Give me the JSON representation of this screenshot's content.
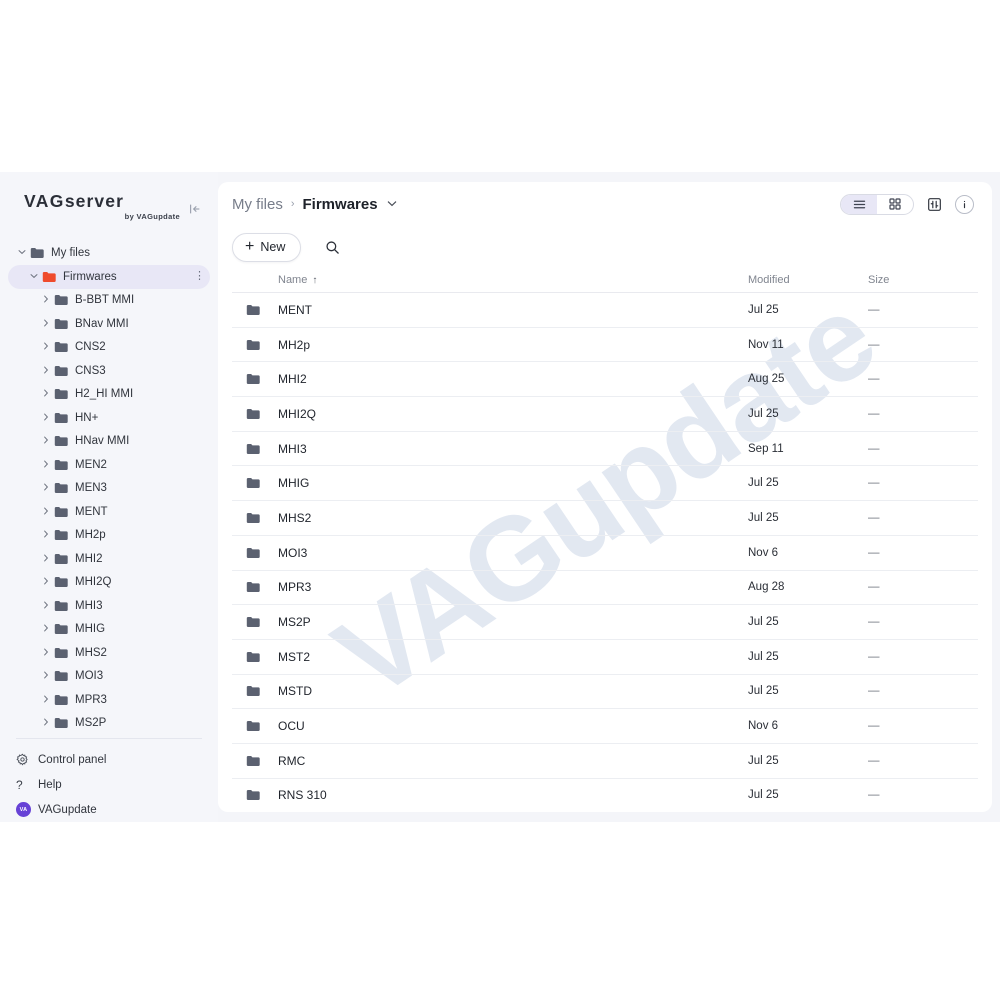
{
  "brand": {
    "title_bold": "VAG",
    "title_light": "server",
    "subtitle": "by VAGupdate",
    "collapse_icon": "collapse-sidebar-icon"
  },
  "watermark": "VAGupdate",
  "sidebar": {
    "tree": [
      {
        "label": "My files",
        "depth": 0,
        "chevron": "down",
        "selected": false,
        "folder_color": "#5b6170"
      },
      {
        "label": "Firmwares",
        "depth": 1,
        "chevron": "down",
        "selected": true,
        "folder_color": "#ef4a2c",
        "kebab": "⋮"
      },
      {
        "label": "B-BBT MMI",
        "depth": 2,
        "chevron": "right",
        "selected": false,
        "folder_color": "#5b6170"
      },
      {
        "label": "BNav MMI",
        "depth": 2,
        "chevron": "right",
        "selected": false,
        "folder_color": "#5b6170"
      },
      {
        "label": "CNS2",
        "depth": 2,
        "chevron": "right",
        "selected": false,
        "folder_color": "#5b6170"
      },
      {
        "label": "CNS3",
        "depth": 2,
        "chevron": "right",
        "selected": false,
        "folder_color": "#5b6170"
      },
      {
        "label": "H2_HI MMI",
        "depth": 2,
        "chevron": "right",
        "selected": false,
        "folder_color": "#5b6170"
      },
      {
        "label": "HN+",
        "depth": 2,
        "chevron": "right",
        "selected": false,
        "folder_color": "#5b6170"
      },
      {
        "label": "HNav MMI",
        "depth": 2,
        "chevron": "right",
        "selected": false,
        "folder_color": "#5b6170"
      },
      {
        "label": "MEN2",
        "depth": 2,
        "chevron": "right",
        "selected": false,
        "folder_color": "#5b6170"
      },
      {
        "label": "MEN3",
        "depth": 2,
        "chevron": "right",
        "selected": false,
        "folder_color": "#5b6170"
      },
      {
        "label": "MENT",
        "depth": 2,
        "chevron": "right",
        "selected": false,
        "folder_color": "#5b6170"
      },
      {
        "label": "MH2p",
        "depth": 2,
        "chevron": "right",
        "selected": false,
        "folder_color": "#5b6170"
      },
      {
        "label": "MHI2",
        "depth": 2,
        "chevron": "right",
        "selected": false,
        "folder_color": "#5b6170"
      },
      {
        "label": "MHI2Q",
        "depth": 2,
        "chevron": "right",
        "selected": false,
        "folder_color": "#5b6170"
      },
      {
        "label": "MHI3",
        "depth": 2,
        "chevron": "right",
        "selected": false,
        "folder_color": "#5b6170"
      },
      {
        "label": "MHIG",
        "depth": 2,
        "chevron": "right",
        "selected": false,
        "folder_color": "#5b6170"
      },
      {
        "label": "MHS2",
        "depth": 2,
        "chevron": "right",
        "selected": false,
        "folder_color": "#5b6170"
      },
      {
        "label": "MOI3",
        "depth": 2,
        "chevron": "right",
        "selected": false,
        "folder_color": "#5b6170"
      },
      {
        "label": "MPR3",
        "depth": 2,
        "chevron": "right",
        "selected": false,
        "folder_color": "#5b6170"
      },
      {
        "label": "MS2P",
        "depth": 2,
        "chevron": "right",
        "selected": false,
        "folder_color": "#5b6170"
      }
    ],
    "bottom": [
      {
        "label": "Control panel",
        "icon": "gear-icon"
      },
      {
        "label": "Help",
        "icon": "question-mark-icon"
      },
      {
        "label": "VAGupdate",
        "icon": "user-avatar",
        "avatar_initials": "VA",
        "avatar_color": "#6742d6"
      }
    ]
  },
  "header": {
    "breadcrumb_root": "My files",
    "breadcrumb_separator": "›",
    "breadcrumb_current": "Firmwares",
    "breadcrumb_chevron": "⌄",
    "view_list_icon": "list-view-icon",
    "view_grid_icon": "grid-view-icon",
    "active_view": "list",
    "panel_icon": "details-panel-icon",
    "info_icon": "info-icon"
  },
  "actions": {
    "new_label": "New",
    "new_plus": "+",
    "search_icon": "search-icon"
  },
  "table": {
    "columns": {
      "name": "Name",
      "modified": "Modified",
      "size": "Size"
    },
    "sort_column": "Name",
    "sort_arrow": "↑",
    "rows": [
      {
        "name": "MENT",
        "modified": "Jul 25",
        "size": "—"
      },
      {
        "name": "MH2p",
        "modified": "Nov 11",
        "size": "—"
      },
      {
        "name": "MHI2",
        "modified": "Aug 25",
        "size": "—"
      },
      {
        "name": "MHI2Q",
        "modified": "Jul 25",
        "size": "—"
      },
      {
        "name": "MHI3",
        "modified": "Sep 11",
        "size": "—"
      },
      {
        "name": "MHIG",
        "modified": "Jul 25",
        "size": "—"
      },
      {
        "name": "MHS2",
        "modified": "Jul 25",
        "size": "—"
      },
      {
        "name": "MOI3",
        "modified": "Nov 6",
        "size": "—"
      },
      {
        "name": "MPR3",
        "modified": "Aug 28",
        "size": "—"
      },
      {
        "name": "MS2P",
        "modified": "Jul 25",
        "size": "—"
      },
      {
        "name": "MST2",
        "modified": "Jul 25",
        "size": "—"
      },
      {
        "name": "MSTD",
        "modified": "Jul 25",
        "size": "—"
      },
      {
        "name": "OCU",
        "modified": "Nov 6",
        "size": "—"
      },
      {
        "name": "RMC",
        "modified": "Jul 25",
        "size": "—"
      },
      {
        "name": "RNS 310",
        "modified": "Jul 25",
        "size": "—"
      }
    ]
  },
  "colors": {
    "sidebar_bg": "#f5f6fa",
    "selected_pill": "#e8e7f6",
    "accent_folder": "#ef4a2c",
    "avatar": "#6742d6",
    "watermark": "#dde4ef"
  }
}
